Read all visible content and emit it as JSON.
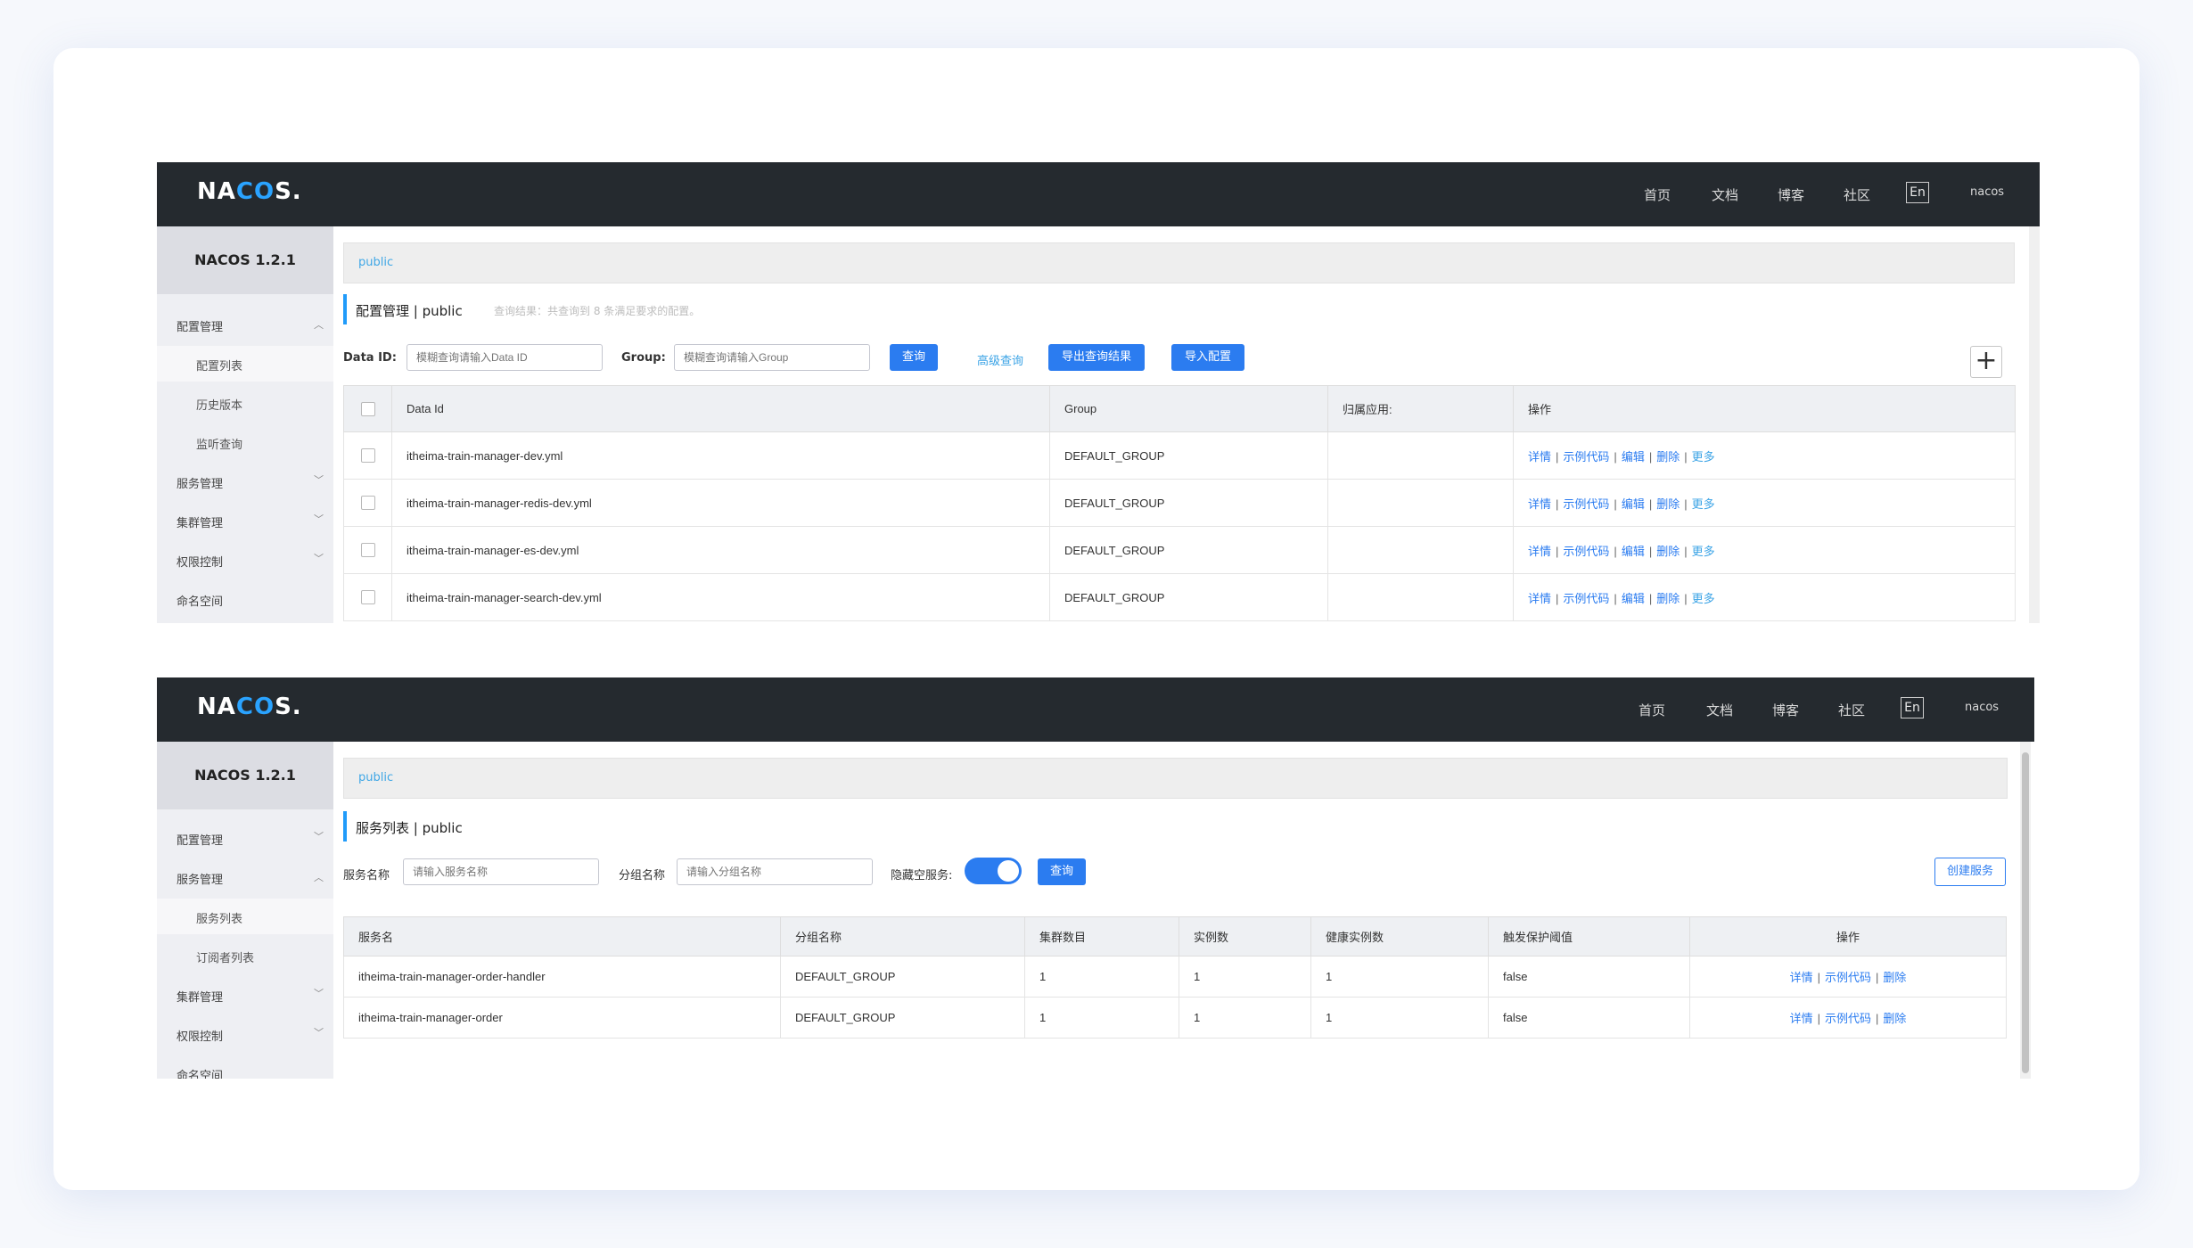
{
  "top_screenshot": {
    "nav": {
      "logo": {
        "pre": "NA",
        "mid": "CO",
        "post": "S."
      },
      "links": [
        "首页",
        "文档",
        "博客",
        "社区"
      ],
      "lang": "En",
      "user": "nacos"
    },
    "sidebar": {
      "title": "NACOS 1.2.1",
      "items": [
        {
          "label": "配置管理",
          "expanded": true
        },
        {
          "label": "配置列表",
          "sub": true,
          "active": true
        },
        {
          "label": "历史版本",
          "sub": true
        },
        {
          "label": "监听查询",
          "sub": true
        },
        {
          "label": "服务管理",
          "expanded": false
        },
        {
          "label": "集群管理",
          "expanded": false
        },
        {
          "label": "权限控制",
          "expanded": false
        },
        {
          "label": "命名空间"
        }
      ]
    },
    "breadcrumb": "public",
    "page_title": "配置管理 | public",
    "query_hint": "查询结果：共查询到 8 条满足要求的配置。",
    "filters": {
      "dataid_label": "Data ID:",
      "dataid_placeholder": "模糊查询请输入Data ID",
      "group_label": "Group:",
      "group_placeholder": "模糊查询请输入Group",
      "query_button": "查询",
      "advanced_link": "高级查询",
      "export_button": "导出查询结果",
      "import_button": "导入配置",
      "add_button": "+"
    },
    "table": {
      "headers": [
        "Data Id",
        "Group",
        "归属应用:",
        "操作"
      ],
      "rows": [
        {
          "data_id": "itheima-train-manager-dev.yml",
          "group": "DEFAULT_GROUP",
          "app": ""
        },
        {
          "data_id": "itheima-train-manager-redis-dev.yml",
          "group": "DEFAULT_GROUP",
          "app": ""
        },
        {
          "data_id": "itheima-train-manager-es-dev.yml",
          "group": "DEFAULT_GROUP",
          "app": ""
        },
        {
          "data_id": "itheima-train-manager-search-dev.yml",
          "group": "DEFAULT_GROUP",
          "app": ""
        }
      ],
      "ops": [
        "详情",
        "示例代码",
        "编辑",
        "删除",
        "更多"
      ]
    }
  },
  "bottom_screenshot": {
    "nav": {
      "logo": {
        "pre": "NA",
        "mid": "CO",
        "post": "S."
      },
      "links": [
        "首页",
        "文档",
        "博客",
        "社区"
      ],
      "lang": "En",
      "user": "nacos"
    },
    "sidebar": {
      "title": "NACOS 1.2.1",
      "items": [
        {
          "label": "配置管理",
          "expanded": false
        },
        {
          "label": "服务管理",
          "expanded": true
        },
        {
          "label": "服务列表",
          "sub": true,
          "active": true
        },
        {
          "label": "订阅者列表",
          "sub": true
        },
        {
          "label": "集群管理",
          "expanded": false
        },
        {
          "label": "权限控制",
          "expanded": false
        },
        {
          "label": "命名空间"
        }
      ]
    },
    "breadcrumb": "public",
    "page_title": "服务列表 | public",
    "filters": {
      "service_label": "服务名称",
      "service_placeholder": "请输入服务名称",
      "group_label": "分组名称",
      "group_placeholder": "请输入分组名称",
      "hide_empty_label": "隐藏空服务:",
      "hide_empty_on": true,
      "query_button": "查询",
      "create_button": "创建服务"
    },
    "table": {
      "headers": [
        "服务名",
        "分组名称",
        "集群数目",
        "实例数",
        "健康实例数",
        "触发保护阈值",
        "操作"
      ],
      "rows": [
        {
          "name": "itheima-train-manager-order-handler",
          "group": "DEFAULT_GROUP",
          "clusters": "1",
          "instances": "1",
          "healthy": "1",
          "threshold": "false"
        },
        {
          "name": "itheima-train-manager-order",
          "group": "DEFAULT_GROUP",
          "clusters": "1",
          "instances": "1",
          "healthy": "1",
          "threshold": "false"
        }
      ],
      "ops": [
        "详情",
        "示例代码",
        "删除"
      ]
    }
  },
  "colors": {
    "nav_bg": "#252a2f",
    "primary": "#2b7cf0",
    "link": "#3aa3e6",
    "sidebar_bg": "#eeeff3"
  }
}
